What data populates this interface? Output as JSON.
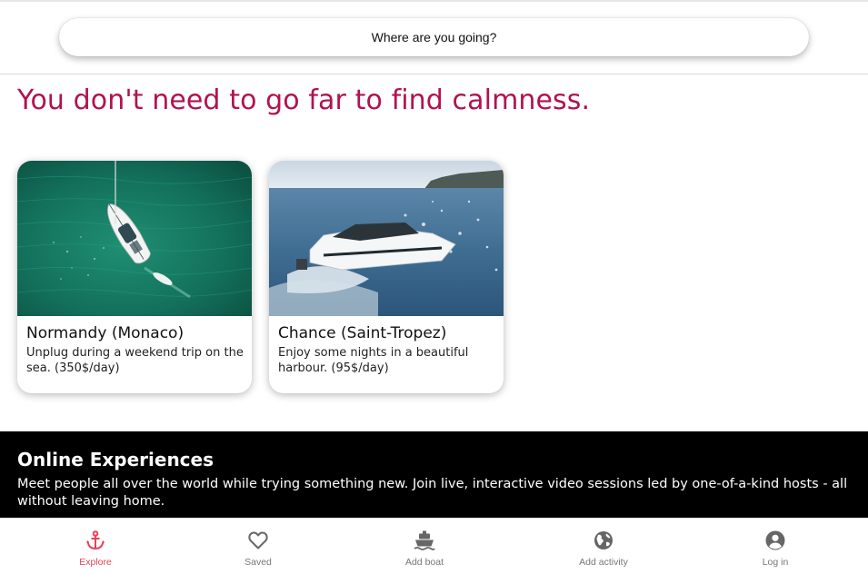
{
  "search": {
    "placeholder": "Where are you going?"
  },
  "headline": "You don't need to go far to find calmness.",
  "cards": [
    {
      "title": "Normandy (Monaco)",
      "description": "Unplug during a weekend trip on the sea. (350$/day)",
      "image": "sailboat-aerial-photo"
    },
    {
      "title": "Chance (Saint-Tropez)",
      "description": "Enjoy some nights in a beautiful harbour. (95$/day)",
      "image": "motor-yacht-photo"
    }
  ],
  "online_experiences": {
    "title": "Online Experiences",
    "description": "Meet people all over the world while trying something new. Join live, interactive video sessions led by one-of-a-kind hosts - all without leaving home."
  },
  "nav": [
    {
      "label": "Explore",
      "icon": "anchor-icon",
      "active": true
    },
    {
      "label": "Saved",
      "icon": "heart-icon",
      "active": false
    },
    {
      "label": "Add boat",
      "icon": "ship-icon",
      "active": false
    },
    {
      "label": "Add activity",
      "icon": "globe-icon",
      "active": false
    },
    {
      "label": "Log in",
      "icon": "user-circle-icon",
      "active": false
    }
  ],
  "colors": {
    "headline": "#b2124f",
    "active_nav": "#e8435a",
    "inactive_nav": "#777777",
    "banner_bg": "#000000"
  }
}
